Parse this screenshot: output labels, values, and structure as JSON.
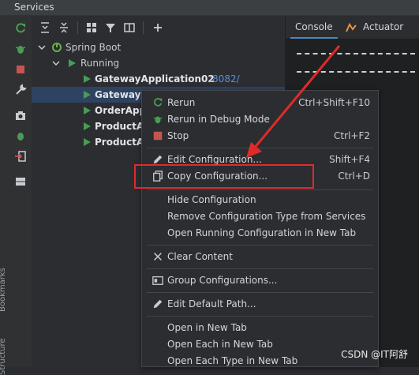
{
  "window": {
    "title": "Services"
  },
  "left_toolbar": {
    "icons": [
      "rerun-icon",
      "debug-icon",
      "stop-icon",
      "wrench-icon",
      "camera-icon",
      "debug2-icon",
      "exit-icon",
      "layout-icon"
    ],
    "vertical_labels": {
      "bookmarks": "Bookmarks",
      "structure": "Structure"
    }
  },
  "toolbar": {
    "icons": [
      "expand-all-icon",
      "collapse-all-icon",
      "group-icon",
      "filter-icon",
      "new-tab-icon",
      "add-icon"
    ]
  },
  "tree": {
    "root": "Spring Boot",
    "group": "Running",
    "items": [
      {
        "label": "GatewayApplication02",
        "port": ":8082/"
      },
      {
        "label": "GatewayA",
        "port": ""
      },
      {
        "label": "OrderApp",
        "port": ""
      },
      {
        "label": "ProductA",
        "port": ""
      },
      {
        "label": "ProductA",
        "port": ""
      }
    ]
  },
  "right_panel": {
    "tabs": [
      {
        "label": "Console"
      },
      {
        "label": "Actuator"
      }
    ]
  },
  "context_menu": {
    "items": [
      {
        "label": "Rerun",
        "shortcut": "Ctrl+Shift+F10",
        "icon": "rerun-icon"
      },
      {
        "label": "Rerun in Debug Mode",
        "shortcut": "",
        "icon": "debug-icon"
      },
      {
        "label": "Stop",
        "shortcut": "Ctrl+F2",
        "icon": "stop-icon"
      },
      {
        "label": "Edit Configuration...",
        "shortcut": "Shift+F4",
        "icon": "pencil-icon"
      },
      {
        "label": "Copy Configuration...",
        "shortcut": "Ctrl+D",
        "icon": "copy-icon"
      },
      {
        "label": "Hide Configuration",
        "shortcut": "",
        "icon": ""
      },
      {
        "label": "Remove Configuration Type from Services",
        "shortcut": "",
        "icon": ""
      },
      {
        "label": "Open Running Configuration in New Tab",
        "shortcut": "",
        "icon": ""
      },
      {
        "label": "Clear Content",
        "shortcut": "",
        "icon": "close-icon"
      },
      {
        "label": "Group Configurations...",
        "shortcut": "",
        "icon": "group-icon"
      },
      {
        "label": "Edit Default Path...",
        "shortcut": "",
        "icon": "pencil-icon"
      },
      {
        "label": "Open in New Tab",
        "shortcut": "",
        "icon": ""
      },
      {
        "label": "Open Each in New Tab",
        "shortcut": "",
        "icon": ""
      },
      {
        "label": "Open Each Type in New Tab",
        "shortcut": "",
        "icon": ""
      }
    ]
  },
  "watermark": "CSDN @IT阿舒",
  "colors": {
    "run_green": "#499c54",
    "stop_red": "#c75450",
    "port_blue": "#5b8fd6",
    "annotation_red": "#e02a2a"
  }
}
